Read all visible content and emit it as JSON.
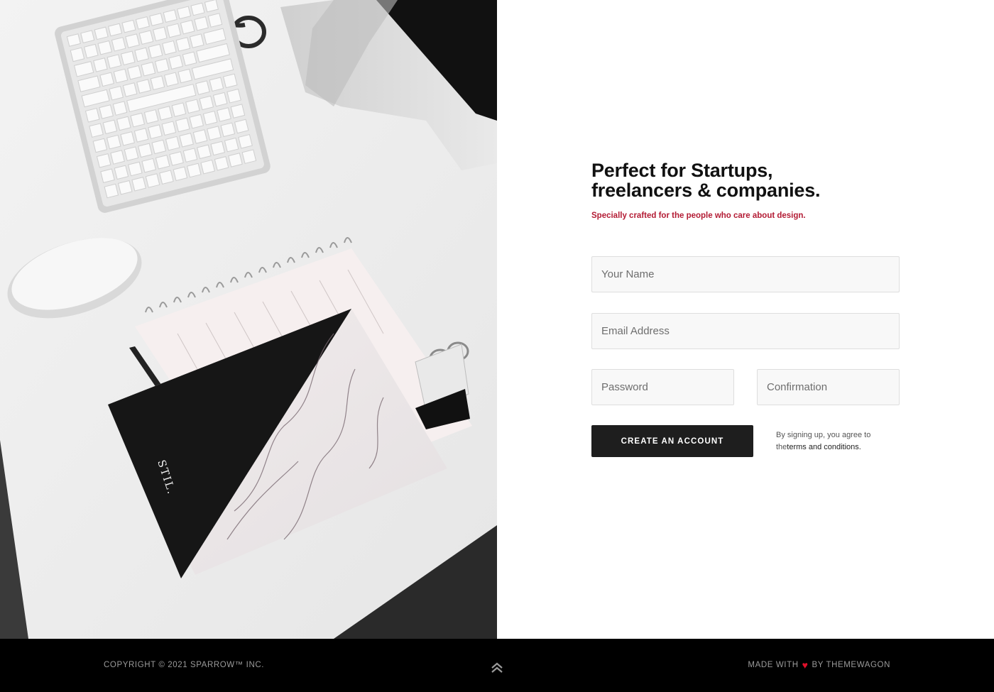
{
  "hero": {
    "title_line1": "Perfect for Startups,",
    "title_line2": "freelancers & companies.",
    "subtitle": "Specially crafted for the people who care about design."
  },
  "form": {
    "name_placeholder": "Your Name",
    "email_placeholder": "Email Address",
    "password_placeholder": "Password",
    "confirmation_placeholder": "Confirmation",
    "submit_label": "CREATE AN ACCOUNT",
    "terms_prefix": "By signing up, you agree to the",
    "terms_link": "terms and conditions."
  },
  "notebook_brand": "STIL.",
  "footer": {
    "copyright": "COPYRIGHT © 2021 SPARROW™ INC.",
    "made_with": "MADE WITH",
    "by": "BY THEMEWAGON",
    "heart_icon": "heart-icon",
    "scroll_icon": "double-chevron-up-icon"
  },
  "colors": {
    "accent_red": "#b31b34",
    "button_dark": "#1e1e1e",
    "footer_bg": "#000000",
    "heart": "#e0102a"
  }
}
